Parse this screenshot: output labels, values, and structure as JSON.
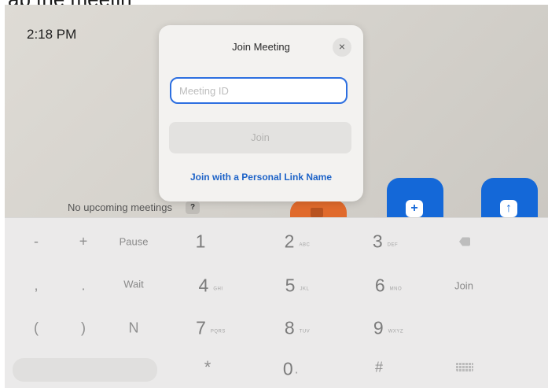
{
  "header": {
    "cut_text": "ap the meetin"
  },
  "home": {
    "clock": "2:18 PM",
    "no_meetings_text": "No upcoming meetings",
    "help_badge": "?",
    "new_tile_icon": "+",
    "share_tile_icon": "↑",
    "colors": {
      "video": "#e06a2c",
      "blue": "#1468d8"
    }
  },
  "dialog": {
    "title": "Join Meeting",
    "close_icon": "×",
    "input_placeholder": "Meeting ID",
    "input_value": "",
    "join_label": "Join",
    "personal_link_label": "Join with a Personal Link Name",
    "accent_color": "#2d6fe0"
  },
  "keypad": {
    "minus": "-",
    "plus": "+",
    "pause": "Pause",
    "comma": ",",
    "period": ".",
    "wait": "Wait",
    "open_paren": "(",
    "close_paren": ")",
    "n": "N",
    "join": "Join",
    "digits": [
      {
        "d": "1",
        "sub": ""
      },
      {
        "d": "2",
        "sub": "ABC"
      },
      {
        "d": "3",
        "sub": "DEF"
      },
      {
        "d": "4",
        "sub": "GHI"
      },
      {
        "d": "5",
        "sub": "JKL"
      },
      {
        "d": "6",
        "sub": "MNO"
      },
      {
        "d": "7",
        "sub": "PQRS"
      },
      {
        "d": "8",
        "sub": "TUV"
      },
      {
        "d": "9",
        "sub": "WXYZ"
      },
      {
        "d": "0",
        "sub": "."
      }
    ],
    "star": "*",
    "hash": "#",
    "backspace_icon": "backspace-icon",
    "keyboard_icon": "keyboard-icon"
  }
}
